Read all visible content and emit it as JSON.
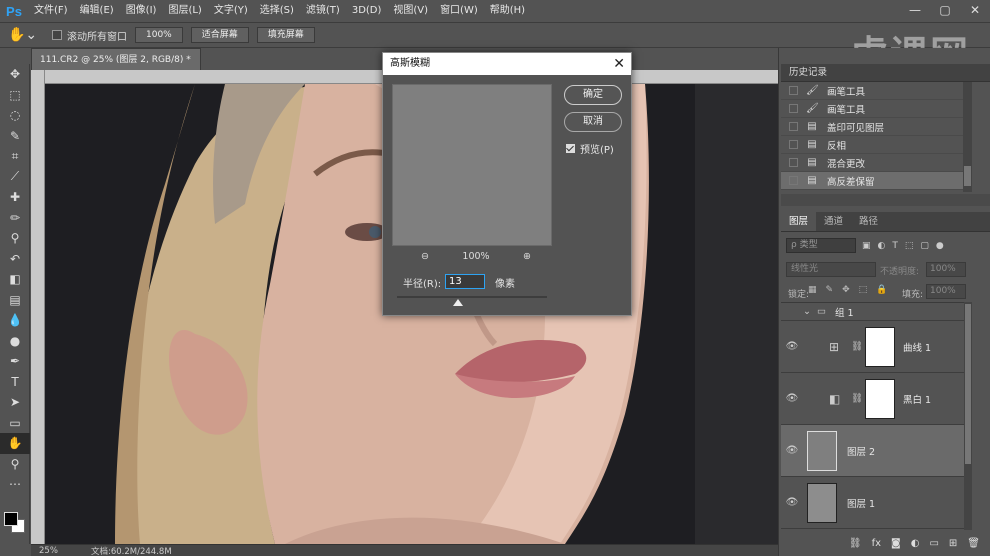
{
  "app": {
    "logo": "Ps"
  },
  "menu": [
    "文件(F)",
    "编辑(E)",
    "图像(I)",
    "图层(L)",
    "文字(Y)",
    "选择(S)",
    "滤镜(T)",
    "3D(D)",
    "视图(V)",
    "窗口(W)",
    "帮助(H)"
  ],
  "window_controls": [
    "—",
    "▢",
    "✕"
  ],
  "options_bar": {
    "scroll_all_label": "滚动所有窗口",
    "zoom_value": "100%",
    "fit_screen": "适合屏幕",
    "fill_screen": "填充屏幕"
  },
  "watermark": "虎课网",
  "document": {
    "tab_title": "111.CR2 @ 25% (图层 2, RGB/8) *",
    "tab_close": "×"
  },
  "status": {
    "zoom": "25%",
    "doc_info": "文档:60.2M/244.8M"
  },
  "history": {
    "title": "历史记录",
    "items": [
      {
        "icon": "brush-icon",
        "label": "画笔工具"
      },
      {
        "icon": "brush-icon",
        "label": "画笔工具"
      },
      {
        "icon": "doc-icon",
        "label": "盖印可见图层"
      },
      {
        "icon": "doc-icon",
        "label": "反相"
      },
      {
        "icon": "doc-icon",
        "label": "混合更改"
      },
      {
        "icon": "doc-icon",
        "label": "高反差保留"
      }
    ],
    "selected_index": 5
  },
  "layers_panel": {
    "tabs": [
      "图层",
      "通道",
      "路径"
    ],
    "active_tab": 0,
    "filter_placeholder": "ρ 类型",
    "blend_mode": "线性光",
    "opacity_label": "不透明度:",
    "opacity_value": "100%",
    "lock_label": "锁定:",
    "fill_label": "填充:",
    "fill_value": "100%",
    "group_name": "组 1",
    "layers": [
      {
        "name": "曲线 1",
        "type": "curves"
      },
      {
        "name": "黑白 1",
        "type": "bw"
      },
      {
        "name": "图层 2",
        "type": "pixel",
        "selected": true
      },
      {
        "name": "图层 1",
        "type": "pixel"
      }
    ]
  },
  "dialog": {
    "title": "高斯模糊",
    "ok": "确定",
    "cancel": "取消",
    "preview_label": "预览(P)",
    "preview_checked": true,
    "zoom": "100%",
    "radius_label": "半径(R):",
    "radius_value": "13",
    "radius_unit": "像素",
    "preview_color": "#7f7f7f"
  },
  "colors": {
    "accent": "#2ea3f2",
    "panel_bg": "#535353",
    "foreground": "#000000",
    "background": "#ffffff"
  }
}
